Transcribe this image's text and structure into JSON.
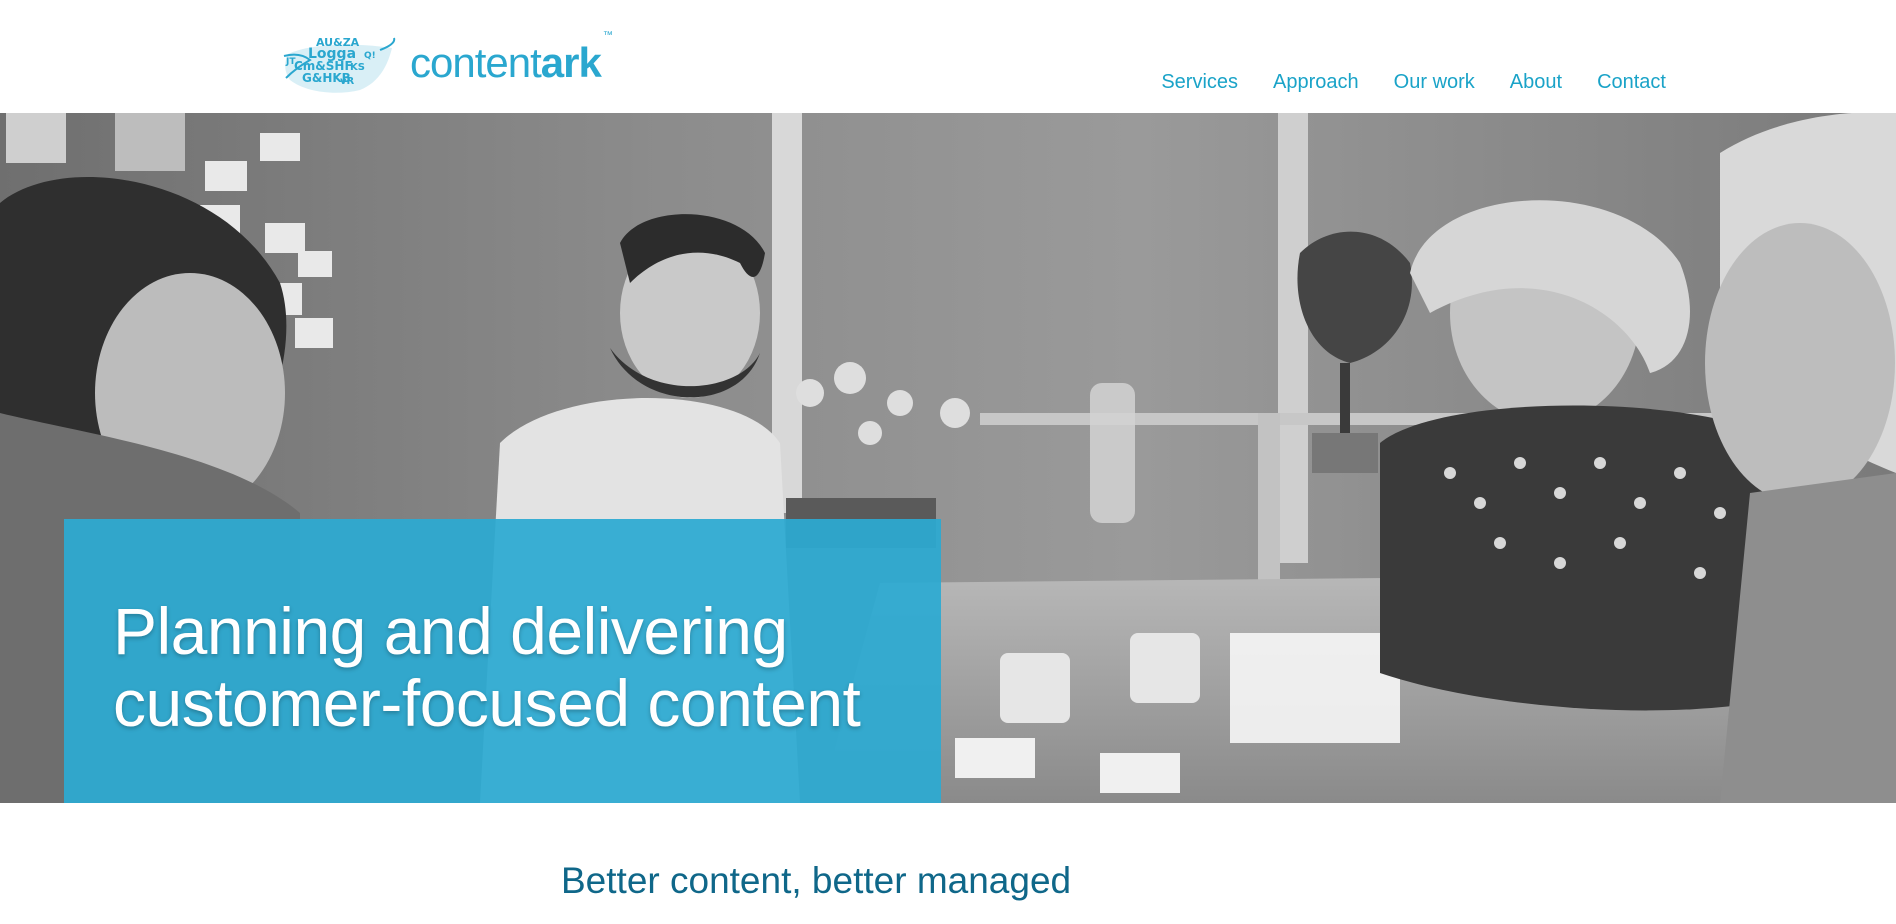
{
  "brand": {
    "name_light": "content",
    "name_bold": "ark",
    "trademark": "™",
    "color": "#2aa7cf"
  },
  "nav": {
    "items": [
      {
        "label": "Services"
      },
      {
        "label": "Approach"
      },
      {
        "label": "Our work"
      },
      {
        "label": "About"
      },
      {
        "label": "Contact"
      }
    ],
    "color": "#1aa3c8"
  },
  "hero": {
    "title_line1": "Planning and delivering",
    "title_line2": "customer-focused content",
    "overlay_color": "#2caad2"
  },
  "intro": {
    "heading": "Better content, better managed",
    "color": "#0f6789"
  }
}
